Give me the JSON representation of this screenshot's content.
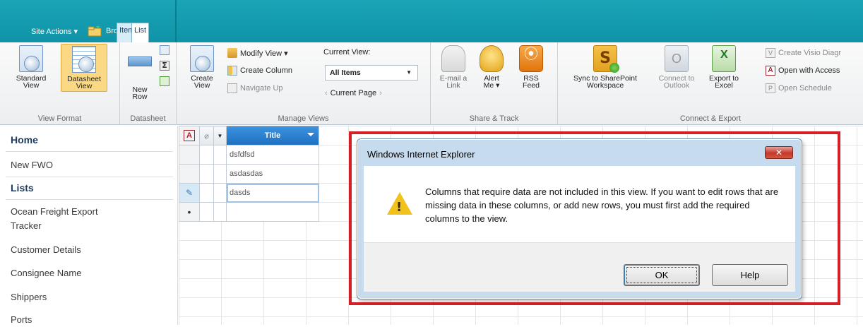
{
  "topbar": {
    "site_actions": "Site Actions ▾",
    "bro": "Bro",
    "tab_item": "Item",
    "tab_list": "List"
  },
  "ribbon": {
    "view_format": {
      "label": "View Format",
      "standard_view": "Standard\nView",
      "datasheet_view": "Datasheet\nView"
    },
    "datasheet": {
      "label": "Datasheet",
      "new_row": "New\nRow"
    },
    "manage_views": {
      "label": "Manage Views",
      "create_view": "Create\nView",
      "modify_view": "Modify View ▾",
      "create_column": "Create Column",
      "navigate_up": "Navigate Up",
      "current_view_label": "Current View:",
      "current_view_value": "All Items",
      "current_page": "Current Page"
    },
    "share_track": {
      "label": "Share & Track",
      "email_link": "E-mail a\nLink",
      "alert_me": "Alert\nMe ▾",
      "rss_feed": "RSS\nFeed"
    },
    "connect_export": {
      "label": "Connect & Export",
      "sync": "Sync to SharePoint\nWorkspace",
      "connect_outlook": "Connect to\nOutlook",
      "export_excel": "Export to\nExcel",
      "create_visio": "Create Visio Diagr",
      "open_access": "Open with Access",
      "open_schedule": "Open Schedule"
    }
  },
  "leftnav": {
    "home": "Home",
    "new_fwo": "New FWO",
    "lists": "Lists",
    "items": [
      "Ocean Freight Export\nTracker",
      "Customer Details",
      "Consignee Name",
      "Shippers",
      "Ports"
    ]
  },
  "grid": {
    "title_header": "Title",
    "rows": [
      "dsfdfsd",
      "asdasdas",
      "dasds",
      ""
    ]
  },
  "dialog": {
    "title": "Windows Internet Explorer",
    "close": "✕",
    "message": "Columns that require data are not included in this view. If you want to edit rows that are missing data in these columns, or add new rows, you must first add the required columns to the view.",
    "ok": "OK",
    "help": "Help"
  },
  "colors": {
    "ribbon_teal": "#1ba4b6",
    "highlight_red": "#d42025",
    "title_header_blue": "#1e6fc0"
  }
}
